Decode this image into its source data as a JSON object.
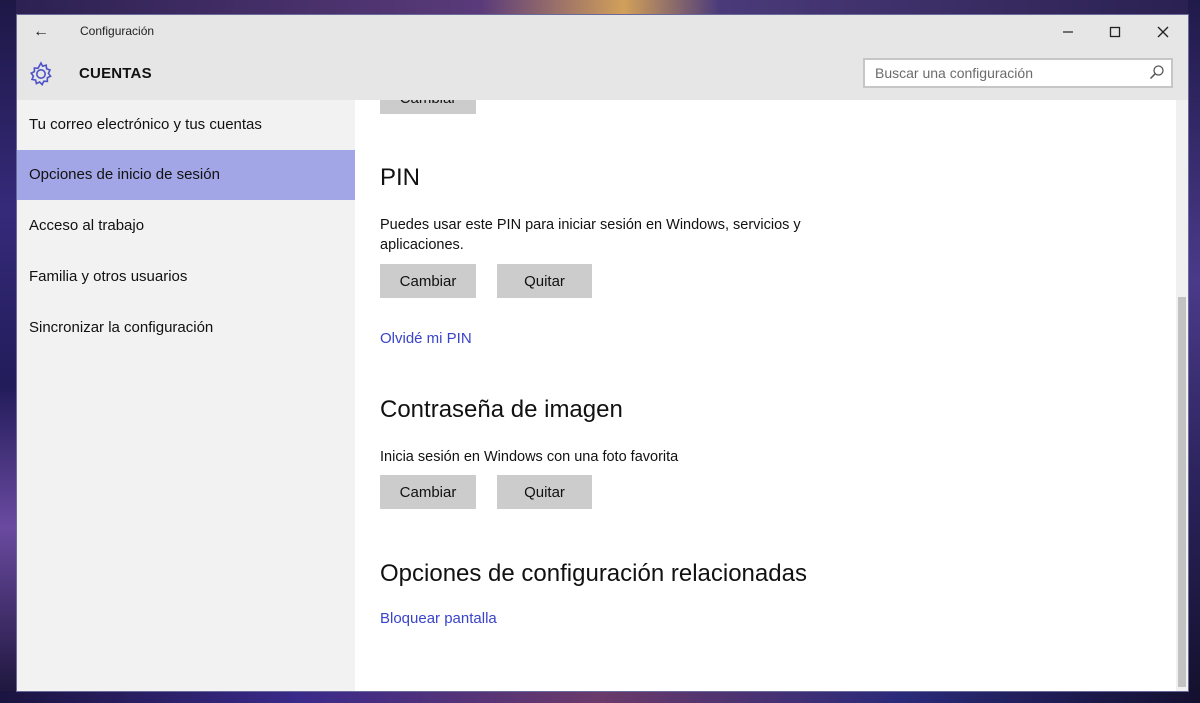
{
  "window": {
    "title": "Configuración",
    "minimize_glyph": "—",
    "maximize_glyph": "☐",
    "close_glyph": "✕",
    "back_glyph": "←"
  },
  "header": {
    "title": "CUENTAS",
    "icon": "gear-icon",
    "accent_color": "#4d52c8"
  },
  "search": {
    "placeholder": "Buscar una configuración",
    "icon": "search-icon"
  },
  "sidebar": {
    "items": [
      {
        "label": "Tu correo electrónico y tus cuentas",
        "selected": false
      },
      {
        "label": "Opciones de inicio de sesión",
        "selected": true
      },
      {
        "label": "Acceso al trabajo",
        "selected": false
      },
      {
        "label": "Familia y otros usuarios",
        "selected": false
      },
      {
        "label": "Sincronizar la configuración",
        "selected": false
      }
    ],
    "selected_color": "#a3a6e6"
  },
  "content": {
    "top_button_label": "Cambiar",
    "pin": {
      "heading": "PIN",
      "description": "Puedes usar este PIN para iniciar sesión en Windows, servicios y aplicaciones.",
      "change_label": "Cambiar",
      "remove_label": "Quitar",
      "forgot_link": "Olvidé mi PIN"
    },
    "picture_password": {
      "heading": "Contraseña de imagen",
      "description": "Inicia sesión en Windows con una foto favorita",
      "change_label": "Cambiar",
      "remove_label": "Quitar"
    },
    "related": {
      "heading": "Opciones de configuración relacionadas",
      "lock_screen_link": "Bloquear pantalla"
    },
    "link_color": "#3a44c8"
  }
}
